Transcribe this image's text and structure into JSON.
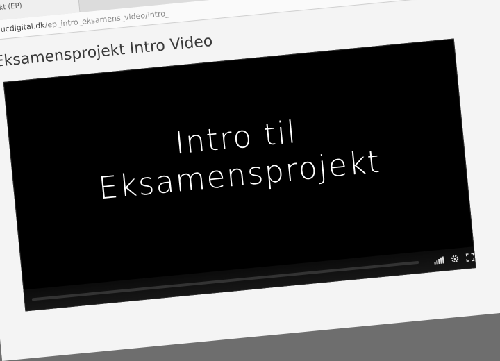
{
  "browser": {
    "tab_title": "projekt (EP)",
    "url_host": "s://vucdigital.dk",
    "url_path": "/ep_intro_eksamens_video/intro_"
  },
  "page": {
    "title": "Eksamensprojekt Intro Video"
  },
  "video": {
    "title_lines": [
      "Intro til",
      "Eksamensprojekt"
    ],
    "progress": 0,
    "icons": [
      "volume-icon",
      "settings-icon",
      "fullscreen-icon"
    ]
  }
}
